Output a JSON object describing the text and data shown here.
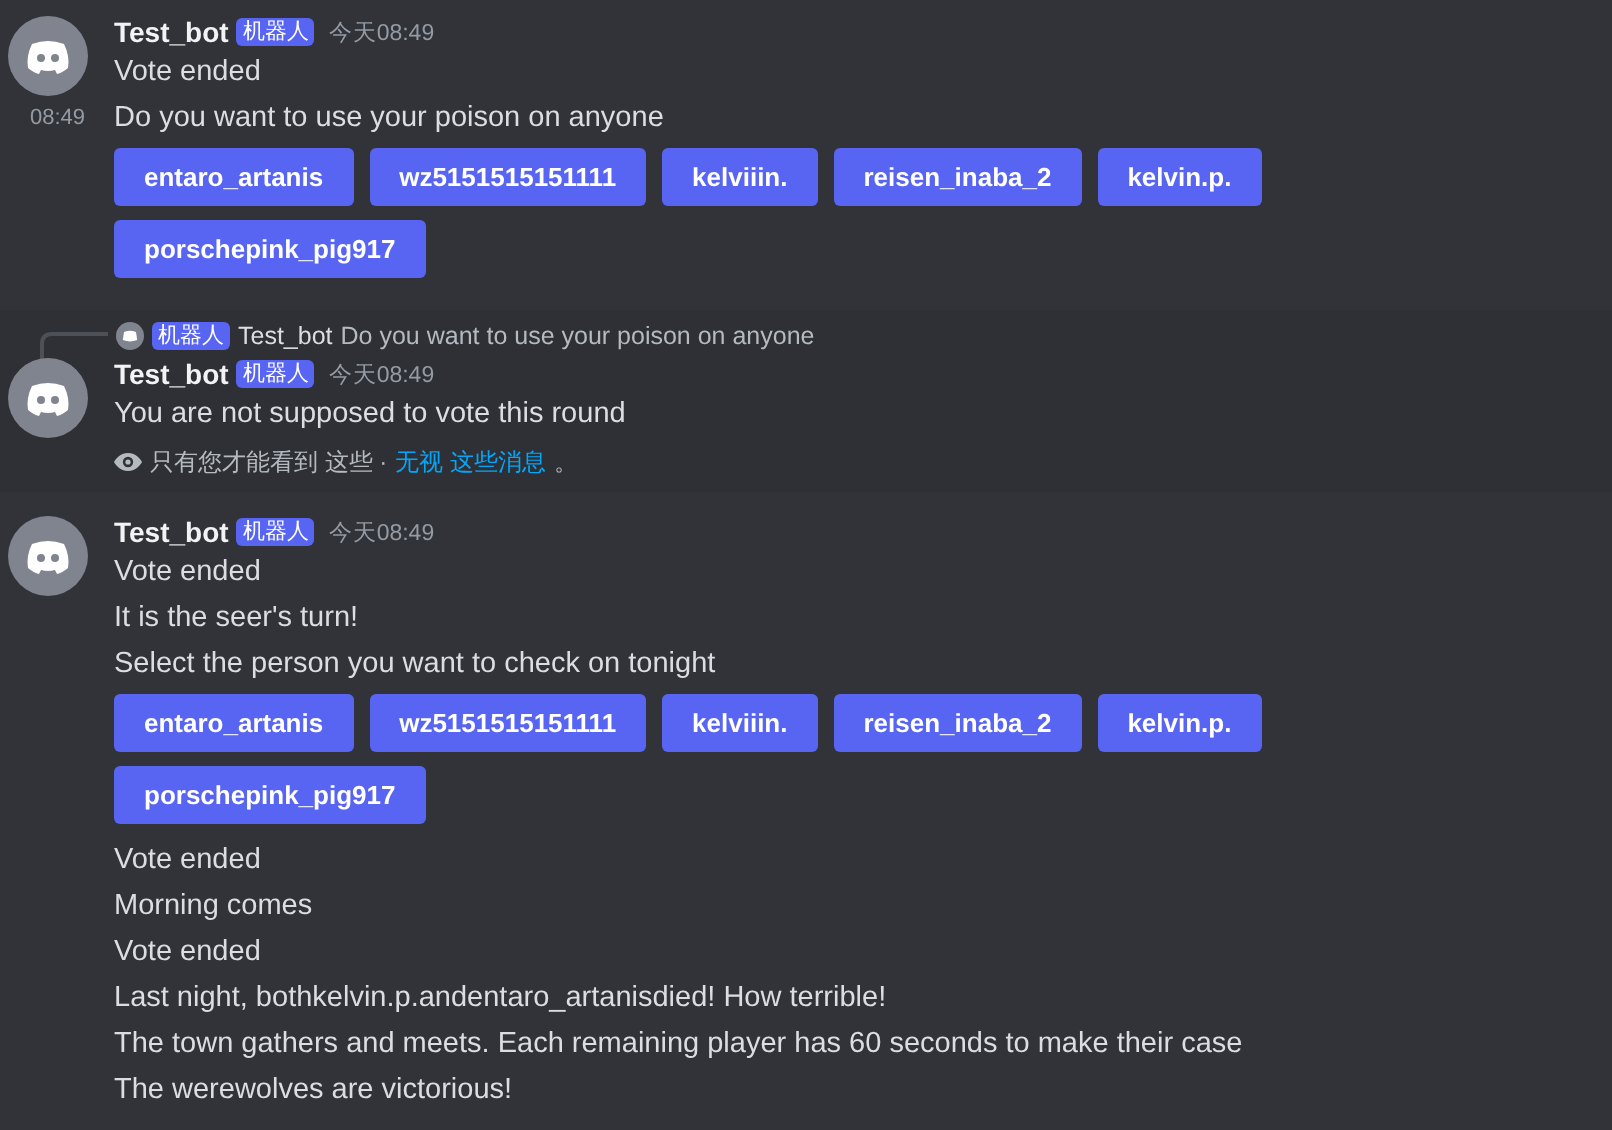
{
  "messages": [
    {
      "ephemeral": false,
      "author": "Test_bot",
      "tag": "机器人",
      "time": "今天08:49",
      "items": [
        {
          "kind": "text",
          "text": "Vote ended"
        },
        {
          "kind": "text",
          "text": "Do you want to use your poison on anyone",
          "side_time": "08:49"
        },
        {
          "kind": "buttons",
          "rows": [
            [
              "entaro_artanis",
              "wz5151515151111",
              "kelviiin.",
              "reisen_inaba_2",
              "kelvin.p."
            ],
            [
              "porschepink_pig917"
            ]
          ]
        }
      ]
    },
    {
      "ephemeral": true,
      "reply": {
        "tag": "机器人",
        "author": "Test_bot",
        "text": "Do you want to use your poison on anyone"
      },
      "author": "Test_bot",
      "tag": "机器人",
      "time": "今天08:49",
      "items": [
        {
          "kind": "text",
          "text": "You are not supposed to vote this round"
        }
      ],
      "notice": {
        "text": "只有您才能看到 这些 ·",
        "link": "无视 这些消息",
        "after": "。"
      }
    },
    {
      "ephemeral": false,
      "author": "Test_bot",
      "tag": "机器人",
      "time": "今天08:49",
      "items": [
        {
          "kind": "text",
          "text": "Vote ended"
        },
        {
          "kind": "text",
          "text": "It is the seer's turn!"
        },
        {
          "kind": "text",
          "text": "Select the person you want to check on tonight"
        },
        {
          "kind": "buttons",
          "rows": [
            [
              "entaro_artanis",
              "wz5151515151111",
              "kelviiin.",
              "reisen_inaba_2",
              "kelvin.p."
            ],
            [
              "porschepink_pig917"
            ]
          ]
        },
        {
          "kind": "text",
          "text": "Vote ended"
        },
        {
          "kind": "text",
          "text": "Morning comes"
        },
        {
          "kind": "text",
          "text": "Vote ended"
        },
        {
          "kind": "text",
          "text": "Last night, bothkelvin.p.andentaro_artanisdied! How terrible!"
        },
        {
          "kind": "text",
          "text": "The town gathers and meets. Each remaining player has 60 seconds to make their case"
        },
        {
          "kind": "text",
          "text": "The werewolves are victorious!"
        }
      ]
    }
  ]
}
